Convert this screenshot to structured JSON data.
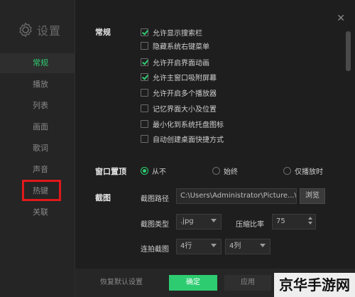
{
  "sidebar": {
    "title": "设置",
    "items": [
      {
        "label": "常规",
        "active": true
      },
      {
        "label": "播放",
        "active": false
      },
      {
        "label": "列表",
        "active": false
      },
      {
        "label": "画面",
        "active": false
      },
      {
        "label": "歌词",
        "active": false
      },
      {
        "label": "声音",
        "active": false
      },
      {
        "label": "热键",
        "active": false
      },
      {
        "label": "关联",
        "active": false
      }
    ]
  },
  "general": {
    "label": "常规",
    "options": [
      {
        "label": "允许显示搜索栏",
        "checked": true
      },
      {
        "label": "隐藏系统右键菜单",
        "checked": false
      },
      {
        "label": "允许开启界面动画",
        "checked": true
      },
      {
        "label": "允许主窗口吸附屏幕",
        "checked": true
      },
      {
        "label": "允许开启多个播放器",
        "checked": false
      },
      {
        "label": "记忆界面大小及位置",
        "checked": false
      },
      {
        "label": "最小化到系统托盘图标",
        "checked": false
      },
      {
        "label": "自动创建桌面快捷方式",
        "checked": false
      }
    ]
  },
  "ontop": {
    "label": "窗口置顶",
    "options": [
      {
        "label": "从不",
        "selected": true
      },
      {
        "label": "始终",
        "selected": false
      },
      {
        "label": "仅播放时",
        "selected": false
      }
    ]
  },
  "screenshot": {
    "label": "截图",
    "path_label": "截图路径",
    "path_value": "C:\\Users\\Administrator\\Picture...\\",
    "browse_label": "浏览",
    "type_label": "截图类型",
    "type_value": ".jpg",
    "ratio_label": "压缩比率",
    "ratio_value": "75",
    "burst_label": "连拍截图",
    "rows_value": "4行",
    "cols_value": "4列"
  },
  "footer": {
    "restore_label": "恢复默认设置",
    "ok_label": "确定",
    "apply_label": "应用",
    "cancel_label": "取消"
  },
  "watermark": "京华手游网",
  "colors": {
    "accent": "#2ecc71",
    "highlight_box": "#e0191b",
    "background": "#1e1e1e"
  },
  "icons": {
    "settings": "gear-icon",
    "close": "close-icon"
  }
}
